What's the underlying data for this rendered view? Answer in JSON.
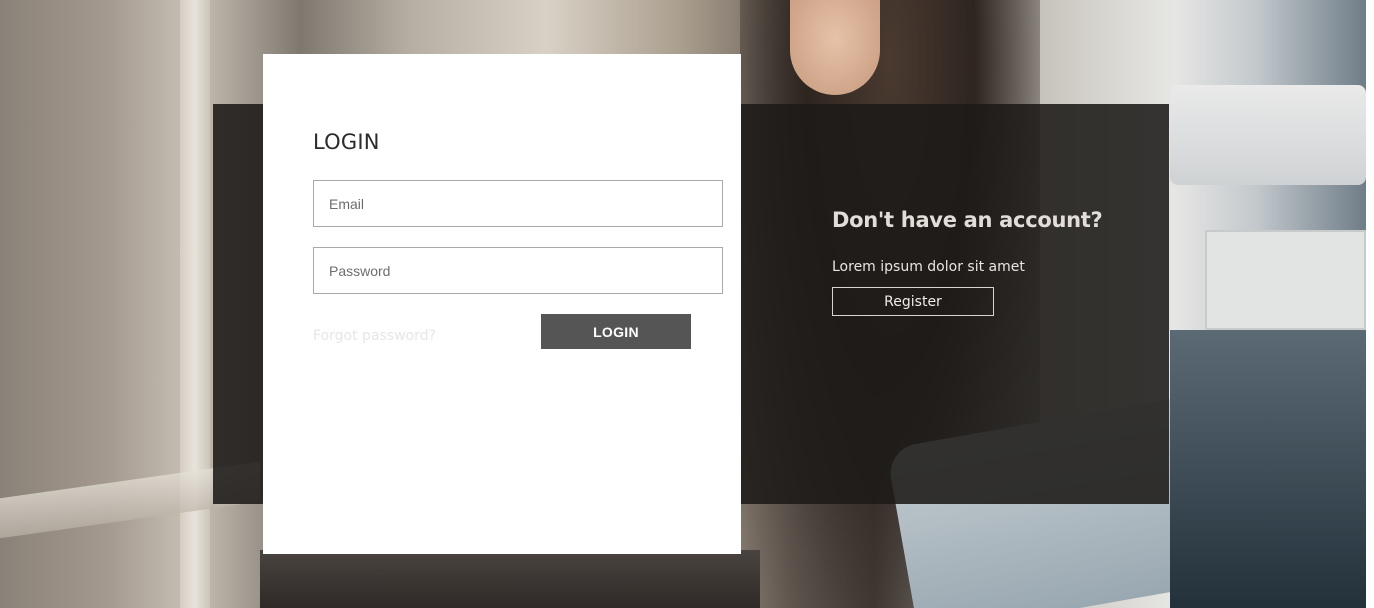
{
  "login": {
    "title": "LOGIN",
    "email_placeholder": "Email",
    "password_placeholder": "Password",
    "forgot_label": "Forgot password?",
    "button_label": "LOGIN"
  },
  "register": {
    "title": "Don't have an account?",
    "text": "Lorem ipsum dolor sit amet",
    "button_label": "Register"
  },
  "colors": {
    "card_bg": "#ffffff",
    "panel_bg": "#1c1a18",
    "button_bg": "#555555"
  }
}
